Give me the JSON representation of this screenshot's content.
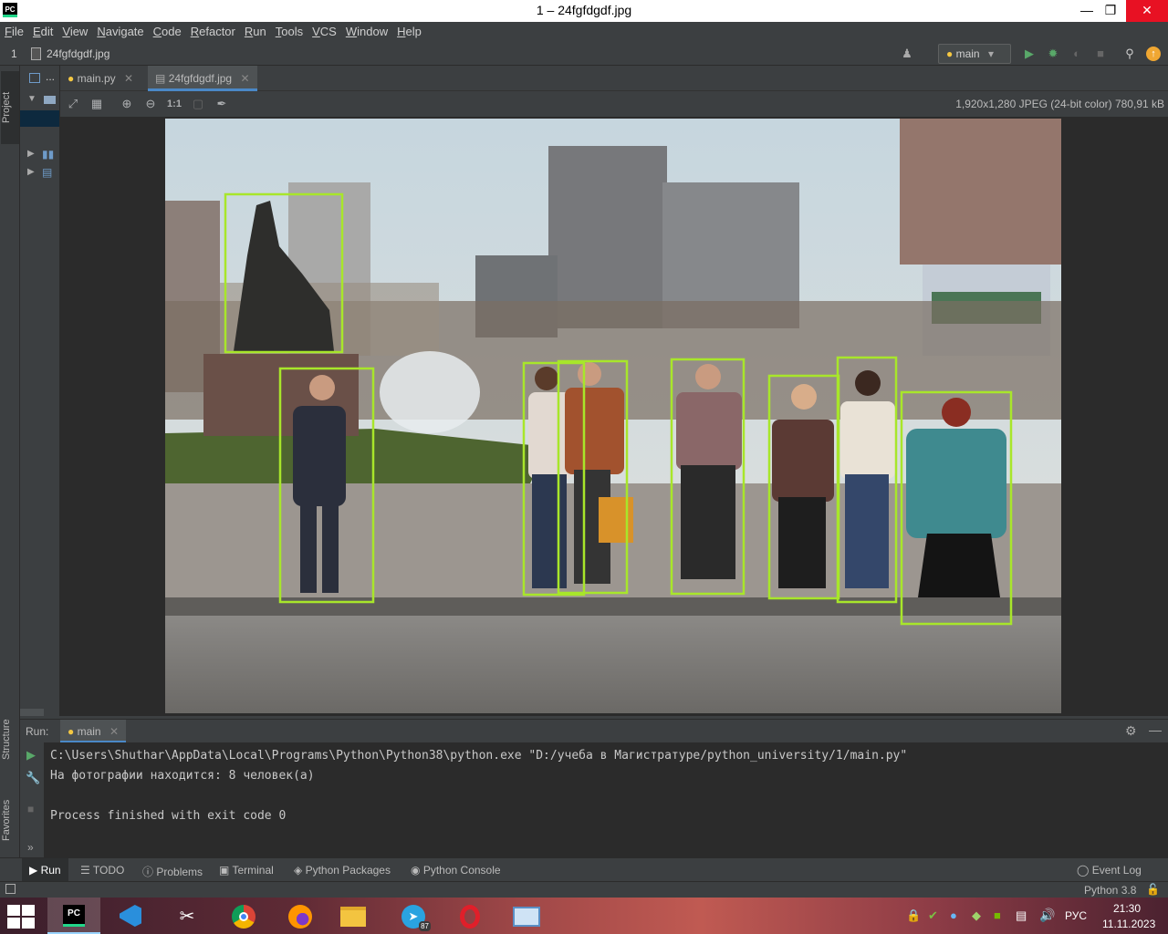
{
  "window": {
    "title": "1 – 24fgfdgdf.jpg",
    "app_icon_label": "PC"
  },
  "menu": [
    "File",
    "Edit",
    "View",
    "Navigate",
    "Code",
    "Refactor",
    "Run",
    "Tools",
    "VCS",
    "Window",
    "Help"
  ],
  "navbar": {
    "project_num": "1",
    "file": "24fgfdgdf.jpg",
    "run_config": "main"
  },
  "left_strip": {
    "project": "Project",
    "structure": "Structure",
    "favorites": "Favorites"
  },
  "project_panel": {
    "dots": "..."
  },
  "editor_tabs": [
    {
      "label": "main.py",
      "active": false
    },
    {
      "label": "24fgfdgdf.jpg",
      "active": true
    }
  ],
  "image_toolbar": {
    "actual_size": "1:1",
    "info": "1,920x1,280 JPEG (24-bit color) 780,91 kB"
  },
  "run_panel": {
    "label": "Run:",
    "tab": "main",
    "lines": [
      "C:\\Users\\Shuthar\\AppData\\Local\\Programs\\Python\\Python38\\python.exe \"D:/учеба в Магистратуре/python_university/1/main.py\"",
      "На фотографии находится: 8 человек(а)",
      "",
      "Process finished with exit code 0"
    ]
  },
  "bottom_tabs": [
    "Run",
    "TODO",
    "Problems",
    "Terminal",
    "Python Packages",
    "Python Console"
  ],
  "event_log": "Event Log",
  "status": {
    "interpreter": "Python 3.8"
  },
  "taskbar": {
    "lang": "РУС",
    "time": "21:30",
    "date": "11.11.2023",
    "telegram_badge": "87"
  },
  "colors": {
    "detection_box": "#a8e62a",
    "accent": "#4a88c7"
  }
}
